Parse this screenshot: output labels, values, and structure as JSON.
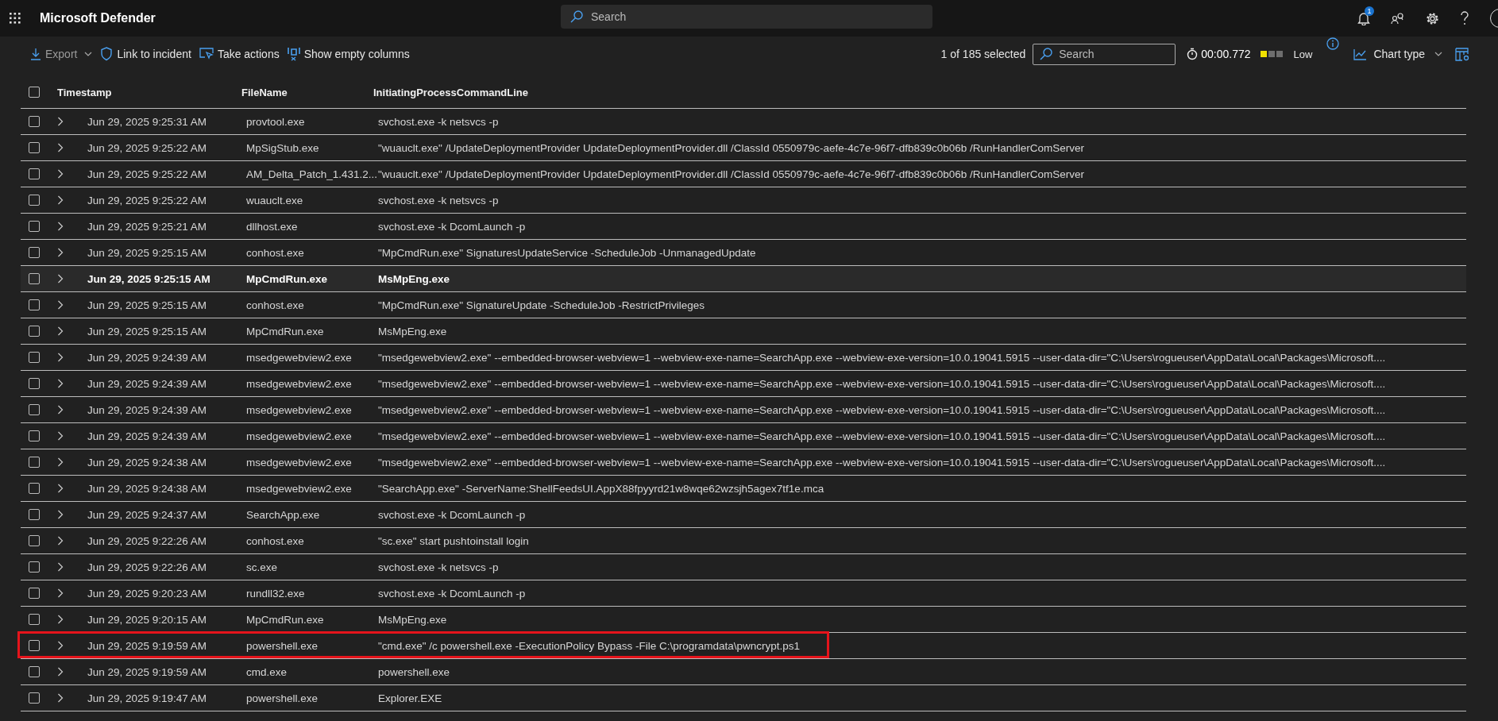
{
  "topbar": {
    "title": "Microsoft Defender",
    "search": {
      "placeholder": "Search"
    },
    "notification_badge": "1"
  },
  "toolbar": {
    "actions": [
      {
        "label": "Export",
        "disabled": true,
        "dropdown": true
      },
      {
        "label": "Link to incident",
        "disabled": false,
        "dropdown": false
      },
      {
        "label": "Take actions",
        "disabled": false,
        "dropdown": false
      },
      {
        "label": "Show empty columns",
        "disabled": false,
        "dropdown": false
      }
    ],
    "selection_count": "1 of 185 selected",
    "search": {
      "placeholder": "Search"
    },
    "duration": "00:00.772",
    "severity": {
      "level": 0.33,
      "label": "Low"
    },
    "chart_type": "Chart type"
  },
  "table": {
    "header_checked": false,
    "columns": [
      "Timestamp",
      "FileName",
      "InitiatingProcessCommandLine"
    ],
    "rows": [
      {
        "timestamp": "Jun 29, 2025 9:25:31 AM",
        "file_name": "provtool.exe",
        "command_line": "svchost.exe -k netsvcs -p",
        "checked": false,
        "selected": false,
        "outlined": false
      },
      {
        "timestamp": "Jun 29, 2025 9:25:22 AM",
        "file_name": "MpSigStub.exe",
        "command_line": "\"wuauclt.exe\" /UpdateDeploymentProvider UpdateDeploymentProvider.dll /ClassId 0550979c-aefe-4c7e-96f7-dfb839c0b06b /RunHandlerComServer",
        "checked": false,
        "selected": false,
        "outlined": false
      },
      {
        "timestamp": "Jun 29, 2025 9:25:22 AM",
        "file_name": "AM_Delta_Patch_1.431.2...",
        "command_line": "\"wuauclt.exe\" /UpdateDeploymentProvider UpdateDeploymentProvider.dll /ClassId 0550979c-aefe-4c7e-96f7-dfb839c0b06b /RunHandlerComServer",
        "checked": false,
        "selected": false,
        "outlined": false
      },
      {
        "timestamp": "Jun 29, 2025 9:25:22 AM",
        "file_name": "wuauclt.exe",
        "command_line": "svchost.exe -k netsvcs -p",
        "checked": false,
        "selected": false,
        "outlined": false
      },
      {
        "timestamp": "Jun 29, 2025 9:25:21 AM",
        "file_name": "dllhost.exe",
        "command_line": "svchost.exe -k DcomLaunch -p",
        "checked": false,
        "selected": false,
        "outlined": false
      },
      {
        "timestamp": "Jun 29, 2025 9:25:15 AM",
        "file_name": "conhost.exe",
        "command_line": "\"MpCmdRun.exe\" SignaturesUpdateService -ScheduleJob -UnmanagedUpdate",
        "checked": false,
        "selected": false,
        "outlined": false
      },
      {
        "timestamp": "Jun 29, 2025 9:25:15 AM",
        "file_name": "MpCmdRun.exe",
        "command_line": "MsMpEng.exe",
        "checked": false,
        "selected": true,
        "outlined": false
      },
      {
        "timestamp": "Jun 29, 2025 9:25:15 AM",
        "file_name": "conhost.exe",
        "command_line": "\"MpCmdRun.exe\" SignatureUpdate -ScheduleJob -RestrictPrivileges",
        "checked": false,
        "selected": false,
        "outlined": false
      },
      {
        "timestamp": "Jun 29, 2025 9:25:15 AM",
        "file_name": "MpCmdRun.exe",
        "command_line": "MsMpEng.exe",
        "checked": false,
        "selected": false,
        "outlined": false
      },
      {
        "timestamp": "Jun 29, 2025 9:24:39 AM",
        "file_name": "msedgewebview2.exe",
        "command_line": "\"msedgewebview2.exe\" --embedded-browser-webview=1 --webview-exe-name=SearchApp.exe --webview-exe-version=10.0.19041.5915 --user-data-dir=\"C:\\Users\\rogueuser\\AppData\\Local\\Packages\\Microsoft....",
        "checked": false,
        "selected": false,
        "outlined": false
      },
      {
        "timestamp": "Jun 29, 2025 9:24:39 AM",
        "file_name": "msedgewebview2.exe",
        "command_line": "\"msedgewebview2.exe\" --embedded-browser-webview=1 --webview-exe-name=SearchApp.exe --webview-exe-version=10.0.19041.5915 --user-data-dir=\"C:\\Users\\rogueuser\\AppData\\Local\\Packages\\Microsoft....",
        "checked": false,
        "selected": false,
        "outlined": false
      },
      {
        "timestamp": "Jun 29, 2025 9:24:39 AM",
        "file_name": "msedgewebview2.exe",
        "command_line": "\"msedgewebview2.exe\" --embedded-browser-webview=1 --webview-exe-name=SearchApp.exe --webview-exe-version=10.0.19041.5915 --user-data-dir=\"C:\\Users\\rogueuser\\AppData\\Local\\Packages\\Microsoft....",
        "checked": false,
        "selected": false,
        "outlined": false
      },
      {
        "timestamp": "Jun 29, 2025 9:24:39 AM",
        "file_name": "msedgewebview2.exe",
        "command_line": "\"msedgewebview2.exe\" --embedded-browser-webview=1 --webview-exe-name=SearchApp.exe --webview-exe-version=10.0.19041.5915 --user-data-dir=\"C:\\Users\\rogueuser\\AppData\\Local\\Packages\\Microsoft....",
        "checked": false,
        "selected": false,
        "outlined": false
      },
      {
        "timestamp": "Jun 29, 2025 9:24:38 AM",
        "file_name": "msedgewebview2.exe",
        "command_line": "\"msedgewebview2.exe\" --embedded-browser-webview=1 --webview-exe-name=SearchApp.exe --webview-exe-version=10.0.19041.5915 --user-data-dir=\"C:\\Users\\rogueuser\\AppData\\Local\\Packages\\Microsoft....",
        "checked": false,
        "selected": false,
        "outlined": false
      },
      {
        "timestamp": "Jun 29, 2025 9:24:38 AM",
        "file_name": "msedgewebview2.exe",
        "command_line": "\"SearchApp.exe\" -ServerName:ShellFeedsUI.AppX88fpyyrd21w8wqe62wzsjh5agex7tf1e.mca",
        "checked": false,
        "selected": false,
        "outlined": false
      },
      {
        "timestamp": "Jun 29, 2025 9:24:37 AM",
        "file_name": "SearchApp.exe",
        "command_line": "svchost.exe -k DcomLaunch -p",
        "checked": false,
        "selected": false,
        "outlined": false
      },
      {
        "timestamp": "Jun 29, 2025 9:22:26 AM",
        "file_name": "conhost.exe",
        "command_line": "\"sc.exe\" start pushtoinstall login",
        "checked": false,
        "selected": false,
        "outlined": false
      },
      {
        "timestamp": "Jun 29, 2025 9:22:26 AM",
        "file_name": "sc.exe",
        "command_line": "svchost.exe -k netsvcs -p",
        "checked": false,
        "selected": false,
        "outlined": false
      },
      {
        "timestamp": "Jun 29, 2025 9:20:23 AM",
        "file_name": "rundll32.exe",
        "command_line": "svchost.exe -k DcomLaunch -p",
        "checked": false,
        "selected": false,
        "outlined": false
      },
      {
        "timestamp": "Jun 29, 2025 9:20:15 AM",
        "file_name": "MpCmdRun.exe",
        "command_line": "MsMpEng.exe",
        "checked": false,
        "selected": false,
        "outlined": false
      },
      {
        "timestamp": "Jun 29, 2025 9:19:59 AM",
        "file_name": "powershell.exe",
        "command_line": "\"cmd.exe\" /c powershell.exe -ExecutionPolicy Bypass -File C:\\programdata\\pwncrypt.ps1",
        "checked": false,
        "selected": false,
        "outlined": true
      },
      {
        "timestamp": "Jun 29, 2025 9:19:59 AM",
        "file_name": "cmd.exe",
        "command_line": "powershell.exe",
        "checked": false,
        "selected": false,
        "outlined": false
      },
      {
        "timestamp": "Jun 29, 2025 9:19:47 AM",
        "file_name": "powershell.exe",
        "command_line": "Explorer.EXE",
        "checked": false,
        "selected": false,
        "outlined": false
      }
    ]
  }
}
